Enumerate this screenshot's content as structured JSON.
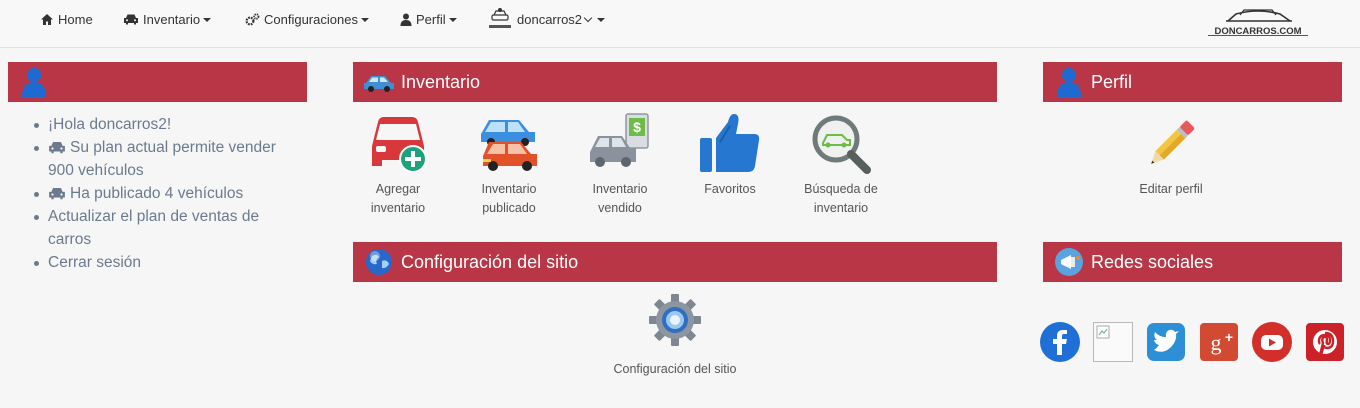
{
  "nav": {
    "home": "Home",
    "inventario": "Inventario",
    "configuraciones": "Configuraciones",
    "perfil": "Perfil",
    "user": "doncarros2",
    "brand_text": "DONCARROS.COM"
  },
  "left": {
    "items": [
      "¡Hola doncarros2!",
      "Su plan actual permite vender 900 vehículos",
      "Ha publicado 4 vehículos",
      "Actualizar el plan de ventas de carros",
      "Cerrar sesión"
    ]
  },
  "inventario": {
    "title": "Inventario",
    "tiles": [
      {
        "label": "Agregar inventario",
        "icon": "add-car-icon"
      },
      {
        "label": "Inventario publicado",
        "icon": "published-cars-icon"
      },
      {
        "label": "Inventario vendido",
        "icon": "sold-car-icon"
      },
      {
        "label": "Favoritos",
        "icon": "thumbs-up-icon"
      },
      {
        "label": "Búsqueda de inventario",
        "icon": "search-car-icon"
      }
    ]
  },
  "perfil": {
    "title": "Perfil",
    "edit_label": "Editar perfil"
  },
  "configuracion": {
    "title": "Configuración del sitio",
    "tile_label": "Configuración del sitio"
  },
  "redes": {
    "title": "Redes sociales",
    "icons": [
      "facebook-icon",
      "broken-image-icon",
      "twitter-icon",
      "google-plus-icon",
      "youtube-icon",
      "pinterest-icon"
    ]
  },
  "colors": {
    "header_bg": "#b83646",
    "text": "#6b7a8f"
  }
}
